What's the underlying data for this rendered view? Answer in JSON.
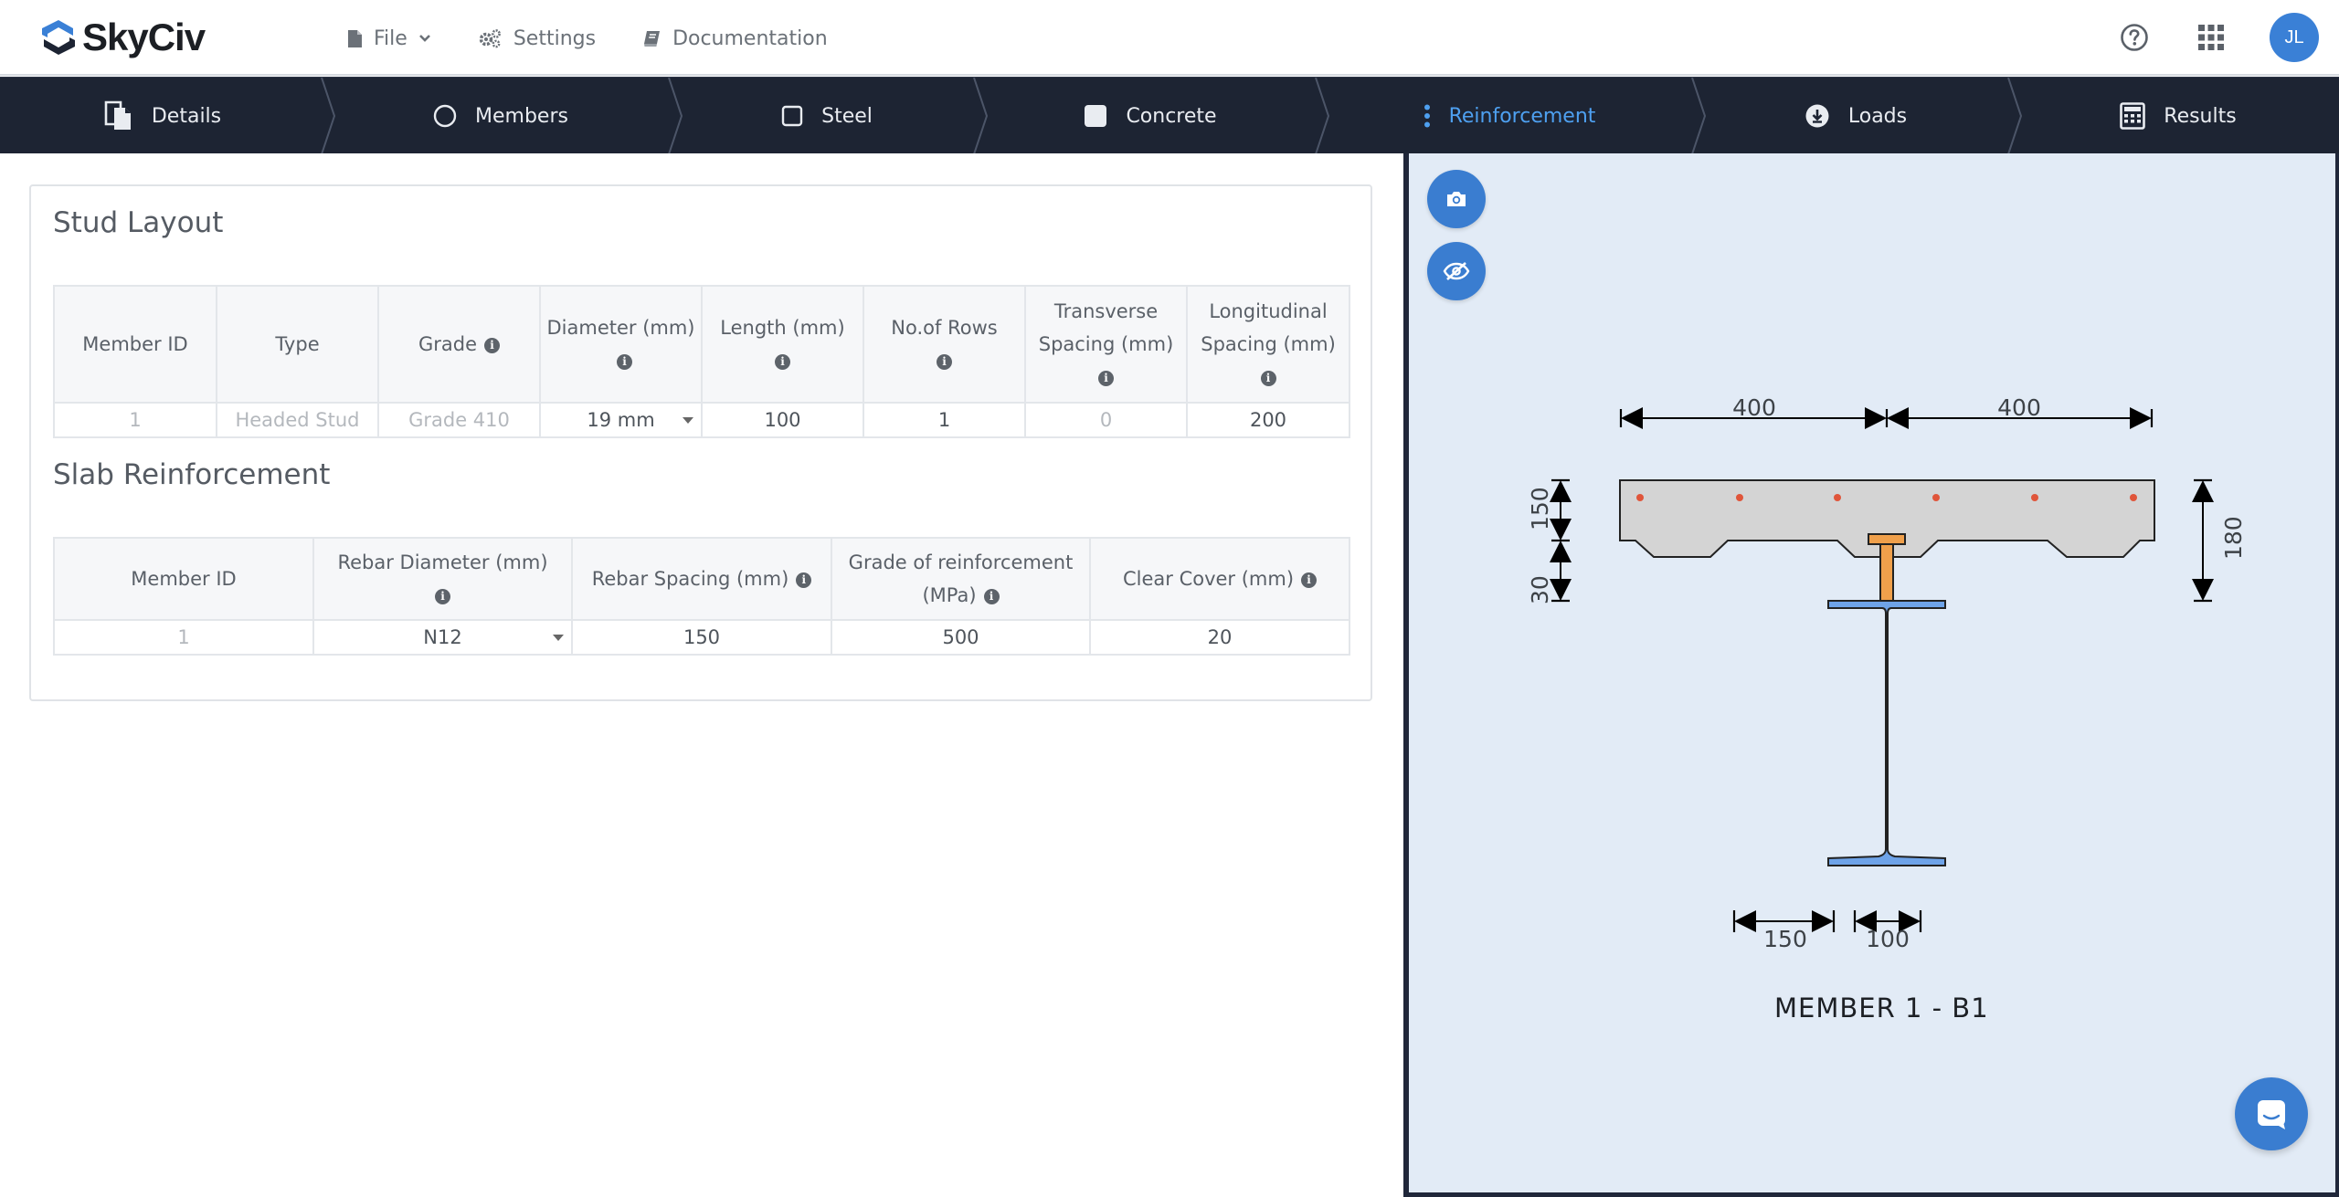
{
  "app": {
    "logo_text": "SkyCiv",
    "brand_color": "#3a80d6"
  },
  "topnav": {
    "file": "File",
    "settings": "Settings",
    "documentation": "Documentation",
    "user_initials": "JL"
  },
  "steps": [
    {
      "label": "Details",
      "icon": "details-icon"
    },
    {
      "label": "Members",
      "icon": "circle-icon"
    },
    {
      "label": "Steel",
      "icon": "square-outline-icon"
    },
    {
      "label": "Concrete",
      "icon": "square-filled-icon"
    },
    {
      "label": "Reinforcement",
      "icon": "vertical-dots-icon",
      "active": true
    },
    {
      "label": "Loads",
      "icon": "download-circle-icon"
    },
    {
      "label": "Results",
      "icon": "calculator-icon"
    }
  ],
  "stud_layout": {
    "title": "Stud Layout",
    "headers": [
      "Member ID",
      "Type",
      "Grade",
      "Diameter (mm)",
      "Length (mm)",
      "No.of Rows",
      "Transverse Spacing (mm)",
      "Longitudinal Spacing (mm)"
    ],
    "row": {
      "member_id": "1",
      "type": "Headed Stud",
      "grade": "Grade 410",
      "diameter": "19 mm",
      "length": "100",
      "rows": "1",
      "transverse_spacing": "0",
      "longitudinal_spacing": "200"
    }
  },
  "slab_reinforcement": {
    "title": "Slab Reinforcement",
    "headers": [
      "Member ID",
      "Rebar Diameter (mm)",
      "Rebar Spacing (mm)",
      "Grade of reinforcement (MPa)",
      "Clear Cover (mm)"
    ],
    "row": {
      "member_id": "1",
      "rebar_diameter": "N12",
      "rebar_spacing": "150",
      "grade": "500",
      "clear_cover": "20"
    }
  },
  "drawing": {
    "dim_left_width": "400",
    "dim_right_width": "400",
    "dim_slab_depth": "150",
    "dim_rib_depth": "30",
    "dim_total_depth": "180",
    "dim_flange": "150",
    "dim_rib_gap": "100",
    "member_label": "MEMBER 1 - B1",
    "colors": {
      "slab": "#d4d4d4",
      "steel": "#6ea3e8",
      "stud": "#f0a04b",
      "rebar": "#e0553a"
    }
  }
}
